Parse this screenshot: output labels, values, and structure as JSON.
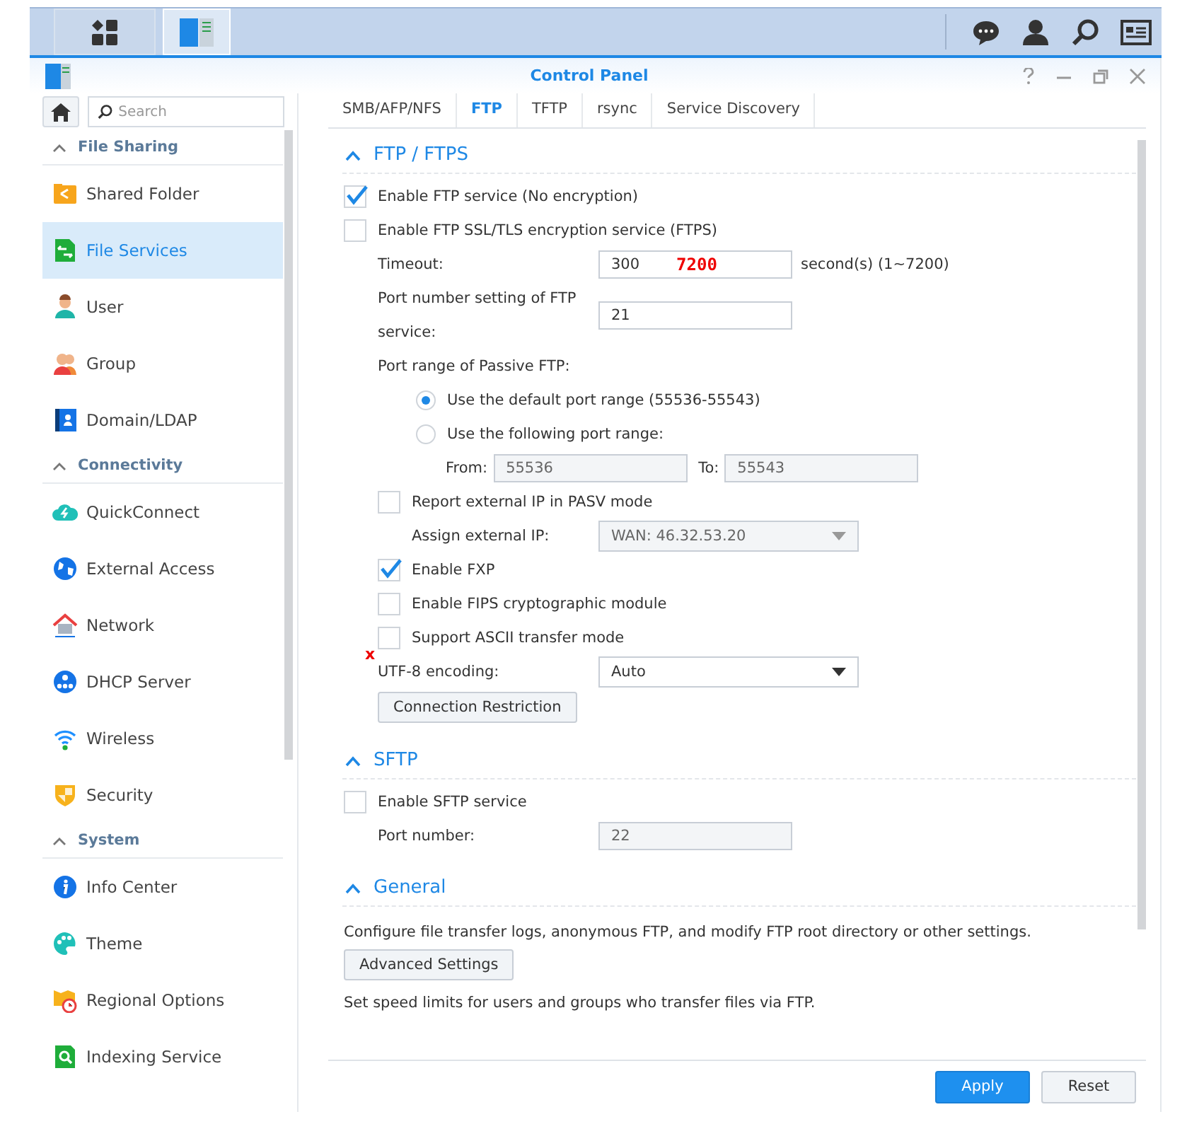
{
  "window": {
    "title": "Control Panel"
  },
  "taskbar": {
    "apps": [
      {
        "selected": false
      },
      {
        "selected": true
      }
    ]
  },
  "sidebar": {
    "search": {
      "placeholder": "Search"
    },
    "groups": [
      {
        "label": "File Sharing",
        "expanded": true,
        "items": [
          {
            "label": "Shared Folder",
            "selected": false
          },
          {
            "label": "File Services",
            "selected": true
          },
          {
            "label": "User",
            "selected": false
          },
          {
            "label": "Group",
            "selected": false
          },
          {
            "label": "Domain/LDAP",
            "selected": false
          }
        ]
      },
      {
        "label": "Connectivity",
        "expanded": true,
        "items": [
          {
            "label": "QuickConnect",
            "selected": false
          },
          {
            "label": "External Access",
            "selected": false
          },
          {
            "label": "Network",
            "selected": false
          },
          {
            "label": "DHCP Server",
            "selected": false
          },
          {
            "label": "Wireless",
            "selected": false
          },
          {
            "label": "Security",
            "selected": false
          }
        ]
      },
      {
        "label": "System",
        "expanded": true,
        "items": [
          {
            "label": "Info Center",
            "selected": false
          },
          {
            "label": "Theme",
            "selected": false
          },
          {
            "label": "Regional Options",
            "selected": false
          },
          {
            "label": "Indexing Service",
            "selected": false
          }
        ]
      }
    ]
  },
  "tabs": [
    {
      "label": "SMB/AFP/NFS",
      "selected": false
    },
    {
      "label": "FTP",
      "selected": true
    },
    {
      "label": "TFTP",
      "selected": false
    },
    {
      "label": "rsync",
      "selected": false
    },
    {
      "label": "Service Discovery",
      "selected": false
    }
  ],
  "sections": [
    {
      "title": "FTP / FTPS",
      "expanded": true,
      "rows": [
        {
          "kind": "checkbox",
          "label": "Enable FTP service (No encryption)",
          "checked": true
        },
        {
          "kind": "checkbox",
          "label": "Enable FTP SSL/TLS encryption service (FTPS)",
          "checked": false,
          "children": [
            {
              "kind": "field",
              "label": "Timeout:",
              "value": "300",
              "annotation": "7200",
              "suffix": "second(s) (1~7200)",
              "disabled": false
            },
            {
              "kind": "field",
              "label": "Port number setting of FTP service:",
              "value": "21",
              "disabled": false
            },
            {
              "kind": "text",
              "label": "Port range of Passive FTP:",
              "children": [
                {
                  "kind": "radio",
                  "label": "Use the default port range (55536-55543)",
                  "selected": true
                },
                {
                  "kind": "radio",
                  "label": "Use the following port range:",
                  "selected": false,
                  "children": [
                    {
                      "kind": "range",
                      "from_label": "From:",
                      "from": "55536",
                      "to_label": "To:",
                      "to": "55543",
                      "disabled": true
                    }
                  ]
                }
              ]
            },
            {
              "kind": "checkbox",
              "label": "Report external IP in PASV mode",
              "checked": false,
              "children": [
                {
                  "kind": "select",
                  "label": "Assign external IP:",
                  "value": "WAN: 46.32.53.20",
                  "disabled": true
                }
              ]
            },
            {
              "kind": "checkbox",
              "label": "Enable FXP",
              "checked": true
            },
            {
              "kind": "checkbox",
              "label": "Enable FIPS cryptographic module",
              "checked": false
            },
            {
              "kind": "checkbox",
              "label": "Support ASCII transfer mode",
              "checked": false,
              "annotation": "x"
            },
            {
              "kind": "select",
              "label": "UTF-8 encoding:",
              "value": "Auto",
              "disabled": false
            },
            {
              "kind": "button",
              "label": "Connection Restriction"
            }
          ]
        }
      ]
    },
    {
      "title": "SFTP",
      "expanded": true,
      "rows": [
        {
          "kind": "checkbox",
          "label": "Enable SFTP service",
          "checked": false,
          "children": [
            {
              "kind": "field",
              "label": "Port number:",
              "value": "22",
              "disabled": true
            }
          ]
        }
      ]
    },
    {
      "title": "General",
      "expanded": true,
      "rows": [
        {
          "kind": "note",
          "label": "Configure file transfer logs, anonymous FTP, and modify FTP root directory or other settings."
        },
        {
          "kind": "button",
          "label": "Advanced Settings"
        },
        {
          "kind": "note",
          "label": "Set speed limits for users and groups who transfer files via FTP."
        }
      ]
    }
  ],
  "footer": {
    "buttons": [
      {
        "label": "Apply",
        "kind": "primary"
      },
      {
        "label": "Reset",
        "kind": "secondary"
      }
    ]
  }
}
